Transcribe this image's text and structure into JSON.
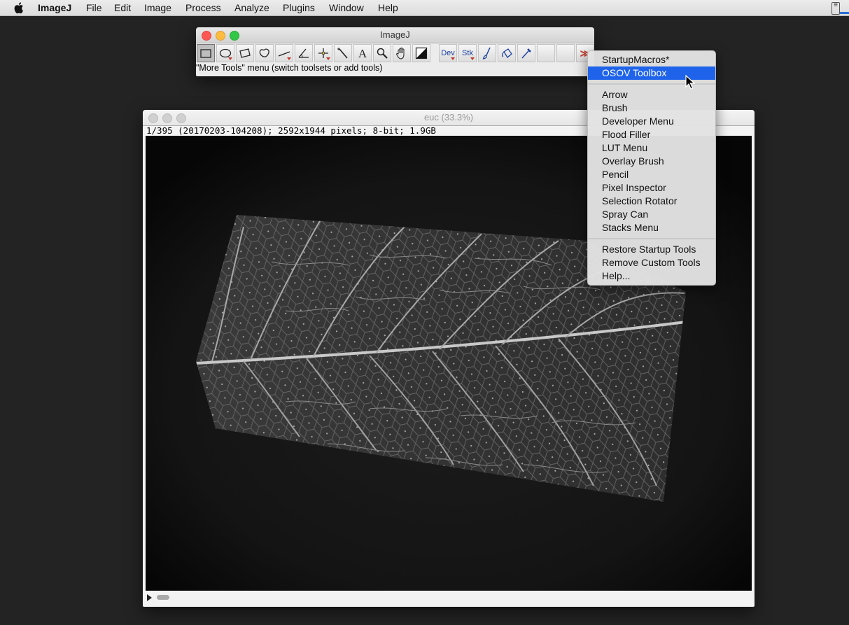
{
  "menubar": {
    "app_name": "ImageJ",
    "items": [
      "File",
      "Edit",
      "Image",
      "Process",
      "Analyze",
      "Plugins",
      "Window",
      "Help"
    ]
  },
  "toolbar_window": {
    "title": "ImageJ",
    "status": "\"More Tools\" menu (switch toolsets or add tools)",
    "tools": [
      {
        "name": "rectangle-tool",
        "icon": "rectangle-selection-icon",
        "selected": true
      },
      {
        "name": "oval-tool",
        "icon": "oval-selection-icon"
      },
      {
        "name": "polygon-tool",
        "icon": "polygon-selection-icon"
      },
      {
        "name": "freehand-tool",
        "icon": "freehand-selection-icon"
      },
      {
        "name": "line-tool",
        "icon": "line-selection-icon"
      },
      {
        "name": "angle-tool",
        "icon": "angle-icon"
      },
      {
        "name": "point-tool",
        "icon": "point-crosshair-icon"
      },
      {
        "name": "wand-tool",
        "icon": "wand-icon"
      },
      {
        "name": "text-tool",
        "icon": "text-icon"
      },
      {
        "name": "zoom-tool",
        "icon": "magnifier-icon"
      },
      {
        "name": "hand-tool",
        "icon": "hand-icon"
      },
      {
        "name": "color-picker-tool",
        "icon": "color-picker-icon"
      },
      {
        "name": "dev-menu-tool",
        "label": "Dev"
      },
      {
        "name": "stk-menu-tool",
        "label": "Stk"
      },
      {
        "name": "brush-tool",
        "icon": "brush-icon"
      },
      {
        "name": "flood-filler-tool",
        "icon": "flood-filler-icon"
      },
      {
        "name": "pipette-tool",
        "icon": "pipette-icon"
      },
      {
        "name": "empty-tool-slot-1"
      },
      {
        "name": "empty-tool-slot-2"
      },
      {
        "name": "more-tools-button",
        "label": "≫"
      }
    ]
  },
  "image_window": {
    "title": "euc (33.3%)",
    "info": "1/395 (20170203-104208); 2592x1944 pixels; 8-bit; 1.9GB"
  },
  "more_tools_menu": {
    "groups": [
      [
        "StartupMacros*",
        "OSOV Toolbox"
      ],
      [
        "Arrow",
        "Brush",
        "Developer Menu",
        "Flood Filler",
        "LUT Menu",
        "Overlay Brush",
        "Pencil",
        "Pixel Inspector",
        "Selection Rotator",
        "Spray Can",
        "Stacks Menu"
      ],
      [
        "Restore Startup Tools",
        "Remove Custom Tools",
        "Help..."
      ]
    ],
    "highlighted": "OSOV Toolbox"
  },
  "colors": {
    "desktop": "#232323",
    "menu_highlight": "#1e63e9",
    "tool_label": "#1a3f9e",
    "more_tools_arrow": "#c0392b"
  }
}
